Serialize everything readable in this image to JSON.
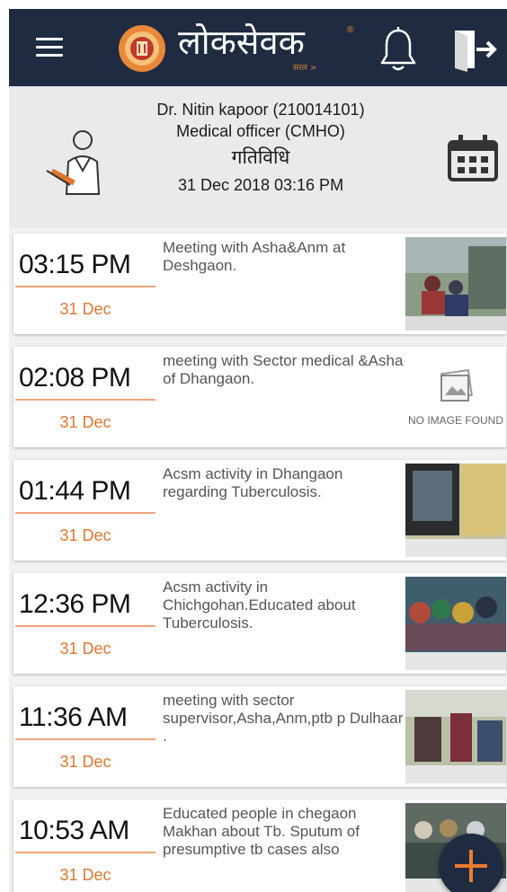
{
  "app": {
    "brand": "लोकसेवक",
    "brand_sub": "सरल >",
    "reg_mark": "®"
  },
  "profile": {
    "name": "Dr. Nitin kapoor (210014101)",
    "role": "Medical officer (CMHO)",
    "section": "गतिविधि",
    "timestamp": "31 Dec 2018 03:16 PM"
  },
  "activities": [
    {
      "time": "03:15 PM",
      "date": "31 Dec",
      "text": "Meeting with Asha&Anm at Deshgaon.",
      "has_image": true
    },
    {
      "time": "02:08 PM",
      "date": "31 Dec",
      "text": "meeting with Sector medical &Asha of Dhangaon.",
      "has_image": false,
      "no_image_text": "NO IMAGE FOUND"
    },
    {
      "time": "01:44 PM",
      "date": "31 Dec",
      "text": "Acsm activity in Dhangaon regarding Tuberculosis.",
      "has_image": true
    },
    {
      "time": "12:36 PM",
      "date": "31 Dec",
      "text": "Acsm activity in Chichgohan.Educated about Tuberculosis.",
      "has_image": true
    },
    {
      "time": "11:36 AM",
      "date": "31 Dec",
      "text": "meeting with sector supervisor,Asha,Anm,ptb p Dulhaar .",
      "has_image": true
    },
    {
      "time": "10:53 AM",
      "date": "31 Dec",
      "text": "Educated people in chegaon Makhan about Tb. Sputum of presumptive tb cases also",
      "has_image": true
    }
  ],
  "colors": {
    "appbar": "#1e2b40",
    "accent": "#e0762f",
    "underline": "#f0a37a"
  },
  "icons": {
    "menu": "menu-icon",
    "bell": "bell-icon",
    "logout": "logout-icon",
    "calendar": "calendar-icon",
    "doctor": "doctor-icon",
    "add": "add-icon"
  }
}
